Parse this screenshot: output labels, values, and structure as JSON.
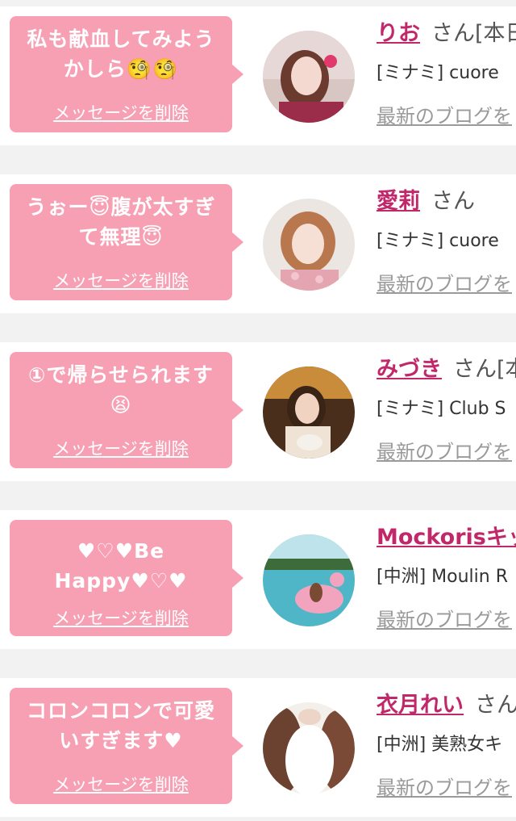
{
  "delete_label": "メッセージを削除",
  "blog_label": "最新のブログを",
  "san": "さん",
  "entries": [
    {
      "message": "私も献血してみよう\nかしら🧐🧐",
      "name": "りお",
      "name_suffix": "[本日",
      "area": "[ミナミ] cuore",
      "avatar": "woman-portrait-pink-photo"
    },
    {
      "message": "うぉー😇腹が太すぎ\nて無理😇",
      "name": "愛莉",
      "name_suffix": "",
      "area": "[ミナミ] cuore",
      "avatar": "woman-portrait-floral-photo"
    },
    {
      "message": "①で帰らせられます\n😫",
      "name": "みづき",
      "name_suffix": "[本",
      "area": "[ミナミ] Club S",
      "avatar": "woman-with-cake-photo"
    },
    {
      "message": "♥♡♥Be Happy♥♡♥",
      "name": "Mockorisキッ",
      "name_suffix": "",
      "area": "[中洲] Moulin R",
      "avatar": "pool-flamingo-photo"
    },
    {
      "message": "コロンコロンで可愛\nいすぎます♥",
      "name": "衣月れい",
      "name_suffix": "",
      "area": "[中洲] 美熟女キ",
      "avatar": "woman-hair-fur-photo"
    }
  ],
  "colors": {
    "bubble": "#f7a0b4",
    "name": "#c1286a",
    "background": "#f2f2f2"
  }
}
